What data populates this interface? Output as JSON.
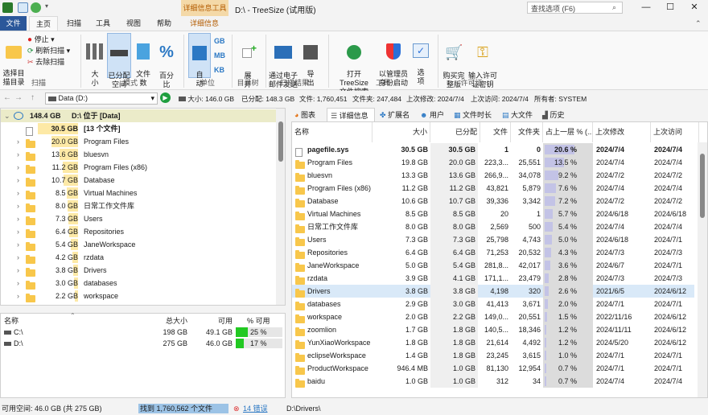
{
  "titlebar": {
    "context_tab": "详细信息工具",
    "title": "D:\\ - TreeSize (试用版)",
    "search_placeholder": "查找选项 (F6)",
    "minimize": "—",
    "maximize": "☐",
    "close": "✕"
  },
  "tabs": [
    "文件",
    "主页",
    "扫描",
    "工具",
    "视图",
    "帮助",
    "详细信息"
  ],
  "ribbon": {
    "scan_group": {
      "select_dir": "选择目\n描目录",
      "stop": "停止",
      "refresh": "刷新扫描",
      "remove": "去除扫描",
      "label": "扫描"
    },
    "mode_group": {
      "size": "大\n小",
      "allocated": "已分配\n空间",
      "files": "文件\n数",
      "percent": "百分\n比",
      "label": "模式"
    },
    "unit_group": {
      "auto": "自\n动",
      "gb": "GB",
      "mb": "MB",
      "kb": "KB",
      "label": "单位"
    },
    "tree_group": {
      "expand": "展\n开",
      "label": "目录树"
    },
    "result_group": {
      "email": "通过电子\n邮件发送",
      "export": "导\n出",
      "label": "扫描结果"
    },
    "tools_group": {
      "open_search": "打开 TreeSize\n文件搜索",
      "admin": "以管理员\n身份启动",
      "options": "选\n项",
      "label": "工具"
    },
    "license_group": {
      "buy": "购买完\n整版",
      "enter": "输入许可\n证密钥",
      "label": "许可证"
    }
  },
  "addressbar": {
    "path": "Data (D:)",
    "size": "大小: 146.0 GB",
    "allocated": "已分配: 148.3 GB",
    "files": "文件: 1,760,451",
    "folders": "文件夹: 247,484",
    "modified": "上次修改: 2024/7/4",
    "accessed": "上次访问: 2024/7/4",
    "owner": "所有者: SYSTEM"
  },
  "tree": {
    "root_size": "148.4 GB",
    "root_label": "D:\\  位于  [Data]",
    "items": [
      {
        "size": "30.5 GB",
        "name": "[13 个文件]",
        "file": true,
        "bar": 1.0
      },
      {
        "size": "20.0 GB",
        "name": "Program Files",
        "bar": 0.66
      },
      {
        "size": "13.6 GB",
        "name": "bluesvn",
        "bar": 0.45
      },
      {
        "size": "11.2 GB",
        "name": "Program Files (x86)",
        "bar": 0.37
      },
      {
        "size": "10.7 GB",
        "name": "Database",
        "bar": 0.35
      },
      {
        "size": "8.5 GB",
        "name": "Virtual Machines",
        "bar": 0.28
      },
      {
        "size": "8.0 GB",
        "name": "日常工作文件库",
        "bar": 0.26
      },
      {
        "size": "7.3 GB",
        "name": "Users",
        "bar": 0.24
      },
      {
        "size": "6.4 GB",
        "name": "Repositories",
        "bar": 0.21
      },
      {
        "size": "5.4 GB",
        "name": "JaneWorkspace",
        "bar": 0.18
      },
      {
        "size": "4.2 GB",
        "name": "rzdata",
        "bar": 0.14
      },
      {
        "size": "3.8 GB",
        "name": "Drivers",
        "bar": 0.12
      },
      {
        "size": "3.0 GB",
        "name": "databases",
        "bar": 0.1
      },
      {
        "size": "2.2 GB",
        "name": "workspace",
        "bar": 0.07
      }
    ]
  },
  "drives": {
    "headers": [
      "名称",
      "总大小",
      "可用",
      "% 可用"
    ],
    "rows": [
      {
        "name": "C:\\",
        "total": "198 GB",
        "free": "49.1 GB",
        "pct": "25 %",
        "fill": 0.25
      },
      {
        "name": "D:\\",
        "total": "275 GB",
        "free": "46.0 GB",
        "pct": "17 %",
        "fill": 0.17
      }
    ]
  },
  "right_tabs": [
    "图表",
    "详细信息",
    "扩展名",
    "用户",
    "文件时长",
    "大文件",
    "历史"
  ],
  "list": {
    "headers": [
      "名称",
      "大小",
      "已分配",
      "文件",
      "文件夹",
      "占上一层 % (...",
      "上次修改",
      "上次访问"
    ],
    "rows": [
      {
        "name": "pagefile.sys",
        "size": "30.5 GB",
        "alloc": "30.5 GB",
        "files": "1",
        "folders": "0",
        "pct": "20.6 %",
        "p": 0.206,
        "mod": "2024/7/4",
        "acc": "2024/7/4",
        "file": true,
        "bold": true
      },
      {
        "name": "Program Files",
        "size": "19.8 GB",
        "alloc": "20.0 GB",
        "files": "223,3...",
        "folders": "25,551",
        "pct": "13.5 %",
        "p": 0.135,
        "mod": "2024/7/4",
        "acc": "2024/7/4"
      },
      {
        "name": "bluesvn",
        "size": "13.3 GB",
        "alloc": "13.6 GB",
        "files": "266,9...",
        "folders": "34,078",
        "pct": "9.2 %",
        "p": 0.092,
        "mod": "2024/7/2",
        "acc": "2024/7/2"
      },
      {
        "name": "Program Files (x86)",
        "size": "11.2 GB",
        "alloc": "11.2 GB",
        "files": "43,821",
        "folders": "5,879",
        "pct": "7.6 %",
        "p": 0.076,
        "mod": "2024/7/4",
        "acc": "2024/7/4"
      },
      {
        "name": "Database",
        "size": "10.6 GB",
        "alloc": "10.7 GB",
        "files": "39,336",
        "folders": "3,342",
        "pct": "7.2 %",
        "p": 0.072,
        "mod": "2024/7/2",
        "acc": "2024/7/2"
      },
      {
        "name": "Virtual Machines",
        "size": "8.5 GB",
        "alloc": "8.5 GB",
        "files": "20",
        "folders": "1",
        "pct": "5.7 %",
        "p": 0.057,
        "mod": "2024/6/18",
        "acc": "2024/6/18"
      },
      {
        "name": "日常工作文件库",
        "size": "8.0 GB",
        "alloc": "8.0 GB",
        "files": "2,569",
        "folders": "500",
        "pct": "5.4 %",
        "p": 0.054,
        "mod": "2024/7/4",
        "acc": "2024/7/4"
      },
      {
        "name": "Users",
        "size": "7.3 GB",
        "alloc": "7.3 GB",
        "files": "25,798",
        "folders": "4,743",
        "pct": "5.0 %",
        "p": 0.05,
        "mod": "2024/6/18",
        "acc": "2024/7/1"
      },
      {
        "name": "Repositories",
        "size": "6.4 GB",
        "alloc": "6.4 GB",
        "files": "71,253",
        "folders": "20,532",
        "pct": "4.3 %",
        "p": 0.043,
        "mod": "2024/7/3",
        "acc": "2024/7/3"
      },
      {
        "name": "JaneWorkspace",
        "size": "5.0 GB",
        "alloc": "5.4 GB",
        "files": "281,8...",
        "folders": "42,017",
        "pct": "3.6 %",
        "p": 0.036,
        "mod": "2024/6/7",
        "acc": "2024/7/1"
      },
      {
        "name": "rzdata",
        "size": "3.9 GB",
        "alloc": "4.1 GB",
        "files": "171,1...",
        "folders": "23,479",
        "pct": "2.8 %",
        "p": 0.028,
        "mod": "2024/7/3",
        "acc": "2024/7/3"
      },
      {
        "name": "Drivers",
        "size": "3.8 GB",
        "alloc": "3.8 GB",
        "files": "4,198",
        "folders": "320",
        "pct": "2.6 %",
        "p": 0.026,
        "mod": "2021/6/5",
        "acc": "2024/6/12",
        "selected": true
      },
      {
        "name": "databases",
        "size": "2.9 GB",
        "alloc": "3.0 GB",
        "files": "41,413",
        "folders": "3,671",
        "pct": "2.0 %",
        "p": 0.02,
        "mod": "2024/7/1",
        "acc": "2024/7/1"
      },
      {
        "name": "workspace",
        "size": "2.0 GB",
        "alloc": "2.2 GB",
        "files": "149,0...",
        "folders": "20,551",
        "pct": "1.5 %",
        "p": 0.015,
        "mod": "2022/11/16",
        "acc": "2024/6/12"
      },
      {
        "name": "zoomlion",
        "size": "1.7 GB",
        "alloc": "1.8 GB",
        "files": "140,5...",
        "folders": "18,346",
        "pct": "1.2 %",
        "p": 0.012,
        "mod": "2024/11/11",
        "acc": "2024/6/12"
      },
      {
        "name": "YunXiaoWorkspace",
        "size": "1.8 GB",
        "alloc": "1.8 GB",
        "files": "21,614",
        "folders": "4,492",
        "pct": "1.2 %",
        "p": 0.012,
        "mod": "2024/5/20",
        "acc": "2024/6/12"
      },
      {
        "name": "eclipseWorkspace",
        "size": "1.4 GB",
        "alloc": "1.8 GB",
        "files": "23,245",
        "folders": "3,615",
        "pct": "1.0 %",
        "p": 0.01,
        "mod": "2024/7/1",
        "acc": "2024/7/1"
      },
      {
        "name": "ProductWorkspace",
        "size": "946.4 MB",
        "alloc": "1.0 GB",
        "files": "81,130",
        "folders": "12,954",
        "pct": "0.7 %",
        "p": 0.007,
        "mod": "2024/7/1",
        "acc": "2024/7/1"
      },
      {
        "name": "baidu",
        "size": "1.0 GB",
        "alloc": "1.0 GB",
        "files": "312",
        "folders": "34",
        "pct": "0.7 %",
        "p": 0.007,
        "mod": "2024/7/4",
        "acc": "2024/7/4"
      }
    ]
  },
  "status": {
    "free": "可用空间: 46.0 GB (共 275 GB)",
    "found": "找到 1,760,562 个文件",
    "errors": "14 错误",
    "path": "D:\\Drivers\\"
  },
  "colors": {
    "accent": "#2b579a",
    "size_bar": "#fde9a6",
    "pct_bar": "#c3c3e6",
    "drive_fill": "#22c922",
    "context_tab": "#f4d9a8"
  }
}
